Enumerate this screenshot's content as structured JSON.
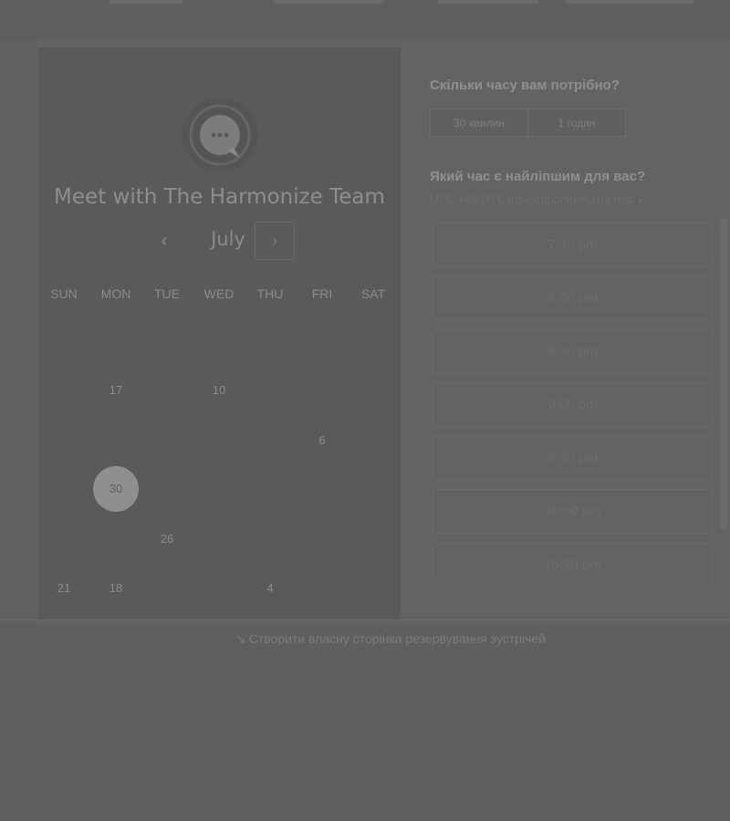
{
  "booking": {
    "title": "Meet with The Harmonize Team",
    "month": "July",
    "prev_icon": "chevron-left-icon",
    "next_icon": "chevron-right-icon",
    "weekdays": [
      "SUN",
      "MON",
      "TUE",
      "WED",
      "THU",
      "FRI",
      "SAT"
    ],
    "days": [
      "17",
      "10",
      "6",
      "30",
      "26",
      "21",
      "18",
      "4"
    ],
    "selected_day": "30"
  },
  "side": {
    "duration_question": "Скільки часу вам потрібно?",
    "durations": [
      "30 хвилин",
      "1 годин"
    ],
    "time_question": "Який час є найліпшим для вас?",
    "timezone": "UTC +03:00 Східноєвропейський час",
    "timezone_caret": "▾",
    "slots": [
      "7:30 pm",
      "8:00 pm",
      "8:30 pm",
      "9:00 pm",
      "9:30 pm",
      "10:00 pm",
      "10:30 pm"
    ]
  },
  "footer": {
    "link": "Створити власну сторінка резервування зустрічей",
    "link_icon": "pointer-icon"
  }
}
